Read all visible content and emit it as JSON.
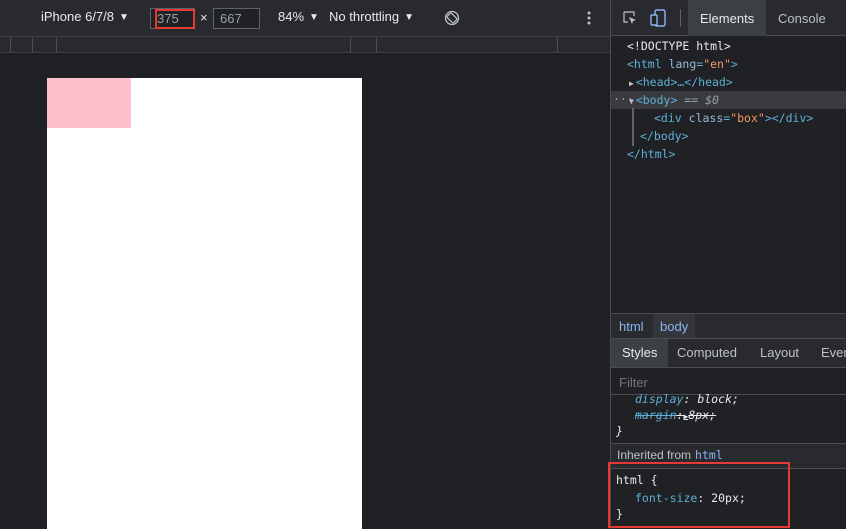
{
  "device_toolbar": {
    "device_name": "iPhone 6/7/8",
    "width": "375",
    "times": "×",
    "height": "667",
    "zoom": "84%",
    "throttling": "No throttling"
  },
  "devtools": {
    "tabs": {
      "elements": "Elements",
      "console": "Console"
    },
    "dom": {
      "doctype": "<!DOCTYPE html>",
      "html_open_tag": "<html",
      "html_attr_name": "lang",
      "html_attr_value": "\"en\"",
      "html_open_close": ">",
      "head_collapsed": "<head>…</head>",
      "ellipsis": "···",
      "body_open": "<body>",
      "body_selected_marker": "== $0",
      "div_open": "<div",
      "div_attr_name": "class",
      "div_attr_value": "\"box\"",
      "div_close": "></div>",
      "body_close": "</body>",
      "html_close": "</html>"
    },
    "breadcrumbs": {
      "html": "html",
      "body": "body"
    },
    "styles_tabs": {
      "styles": "Styles",
      "computed": "Computed",
      "layout": "Layout",
      "event": "Even"
    },
    "filter_placeholder": "Filter",
    "ua_rule": {
      "display_prop": "display",
      "display_value": "block;",
      "margin_prop": "margin",
      "margin_value": "8px;",
      "close_brace": "}"
    },
    "inherited": {
      "label": "Inherited from",
      "link": "html"
    },
    "html_rule": {
      "selector": "html {",
      "prop": "font-size",
      "value": "20px;",
      "close_brace": "}"
    }
  },
  "colors": {
    "box_fill": "#ffc0cb",
    "highlight_border": "#e53935",
    "tag_blue": "#5db0d7",
    "attr_value_orange": "#f29766"
  }
}
